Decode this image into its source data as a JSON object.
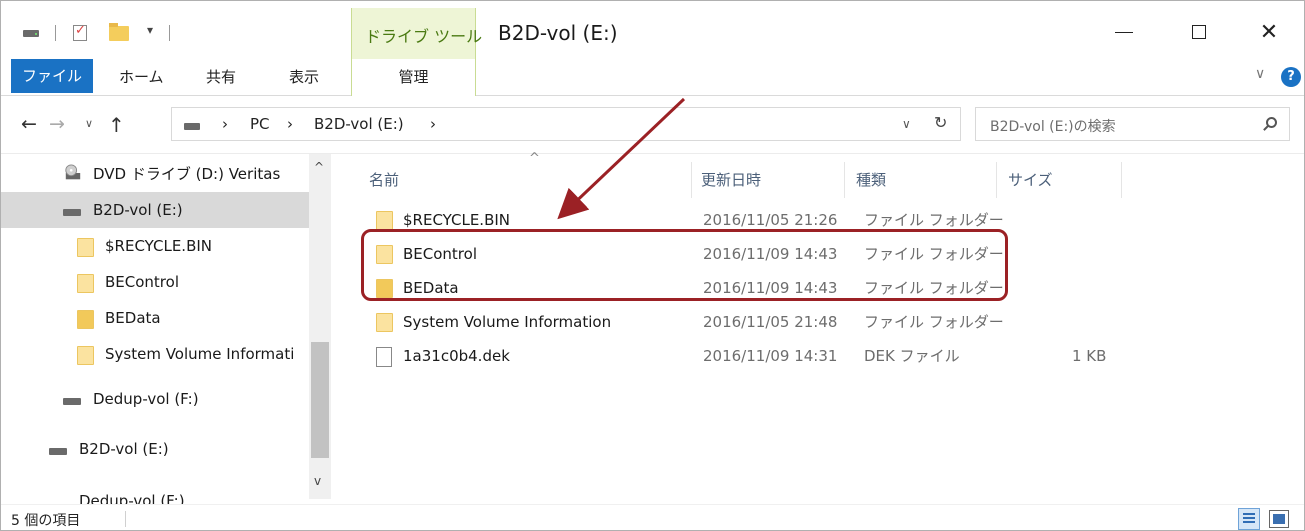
{
  "window": {
    "title": "B2D-vol (E:)",
    "tool_tab_label": "ドライブ ツール",
    "controls": {
      "minimize": "",
      "maximize": "",
      "close": "✕"
    }
  },
  "ribbon": {
    "tabs": {
      "file": "ファイル",
      "home": "ホーム",
      "share": "共有",
      "view": "表示",
      "manage": "管理"
    },
    "expand_glyph": "∨",
    "help_glyph": "?"
  },
  "quick_access": {
    "caret": "▾"
  },
  "address_bar": {
    "back": "←",
    "forward": "→",
    "recent": "∨",
    "up": "↑",
    "separators": [
      "›",
      "›",
      "›"
    ],
    "crumbs": [
      "PC",
      "B2D-vol (E:)"
    ],
    "dropdown": "∨",
    "refresh": "↻"
  },
  "search": {
    "placeholder": "B2D-vol (E:)の検索"
  },
  "nav_pane": {
    "items": [
      {
        "label": "DVD ドライブ (D:) Veritas",
        "icon": "dvd-drive-icon"
      },
      {
        "label": "B2D-vol (E:)",
        "icon": "drive-icon",
        "selected": true
      },
      {
        "label": "$RECYCLE.BIN",
        "icon": "folder-icon"
      },
      {
        "label": "BEControl",
        "icon": "folder-icon"
      },
      {
        "label": "BEData",
        "icon": "folder-icon"
      },
      {
        "label": "System Volume Informati",
        "icon": "folder-icon"
      },
      {
        "label": "Dedup-vol (F:)",
        "icon": "drive-icon"
      },
      {
        "label": "B2D-vol (E:)",
        "icon": "drive-icon"
      },
      {
        "label": "Dedup-vol (F:)",
        "icon": "drive-icon"
      }
    ],
    "scroll_up": "^",
    "scroll_down": "v"
  },
  "columns": {
    "name": "名前",
    "date": "更新日時",
    "type": "種類",
    "size": "サイズ",
    "sort_glyph": "^"
  },
  "files": [
    {
      "name": "$RECYCLE.BIN",
      "date": "2016/11/05 21:26",
      "type": "ファイル フォルダー",
      "size": "",
      "icon": "folder-icon"
    },
    {
      "name": "BEControl",
      "date": "2016/11/09 14:43",
      "type": "ファイル フォルダー",
      "size": "",
      "icon": "folder-icon"
    },
    {
      "name": "BEData",
      "date": "2016/11/09 14:43",
      "type": "ファイル フォルダー",
      "size": "",
      "icon": "folder-icon"
    },
    {
      "name": "System Volume Information",
      "date": "2016/11/05 21:48",
      "type": "ファイル フォルダー",
      "size": "",
      "icon": "folder-icon"
    },
    {
      "name": "1a31c0b4.dek",
      "date": "2016/11/09 14:31",
      "type": "DEK ファイル",
      "size": "1 KB",
      "icon": "file-icon"
    }
  ],
  "status": {
    "item_count": "5 個の項目"
  },
  "annotation": {
    "color": "#9b2125"
  }
}
